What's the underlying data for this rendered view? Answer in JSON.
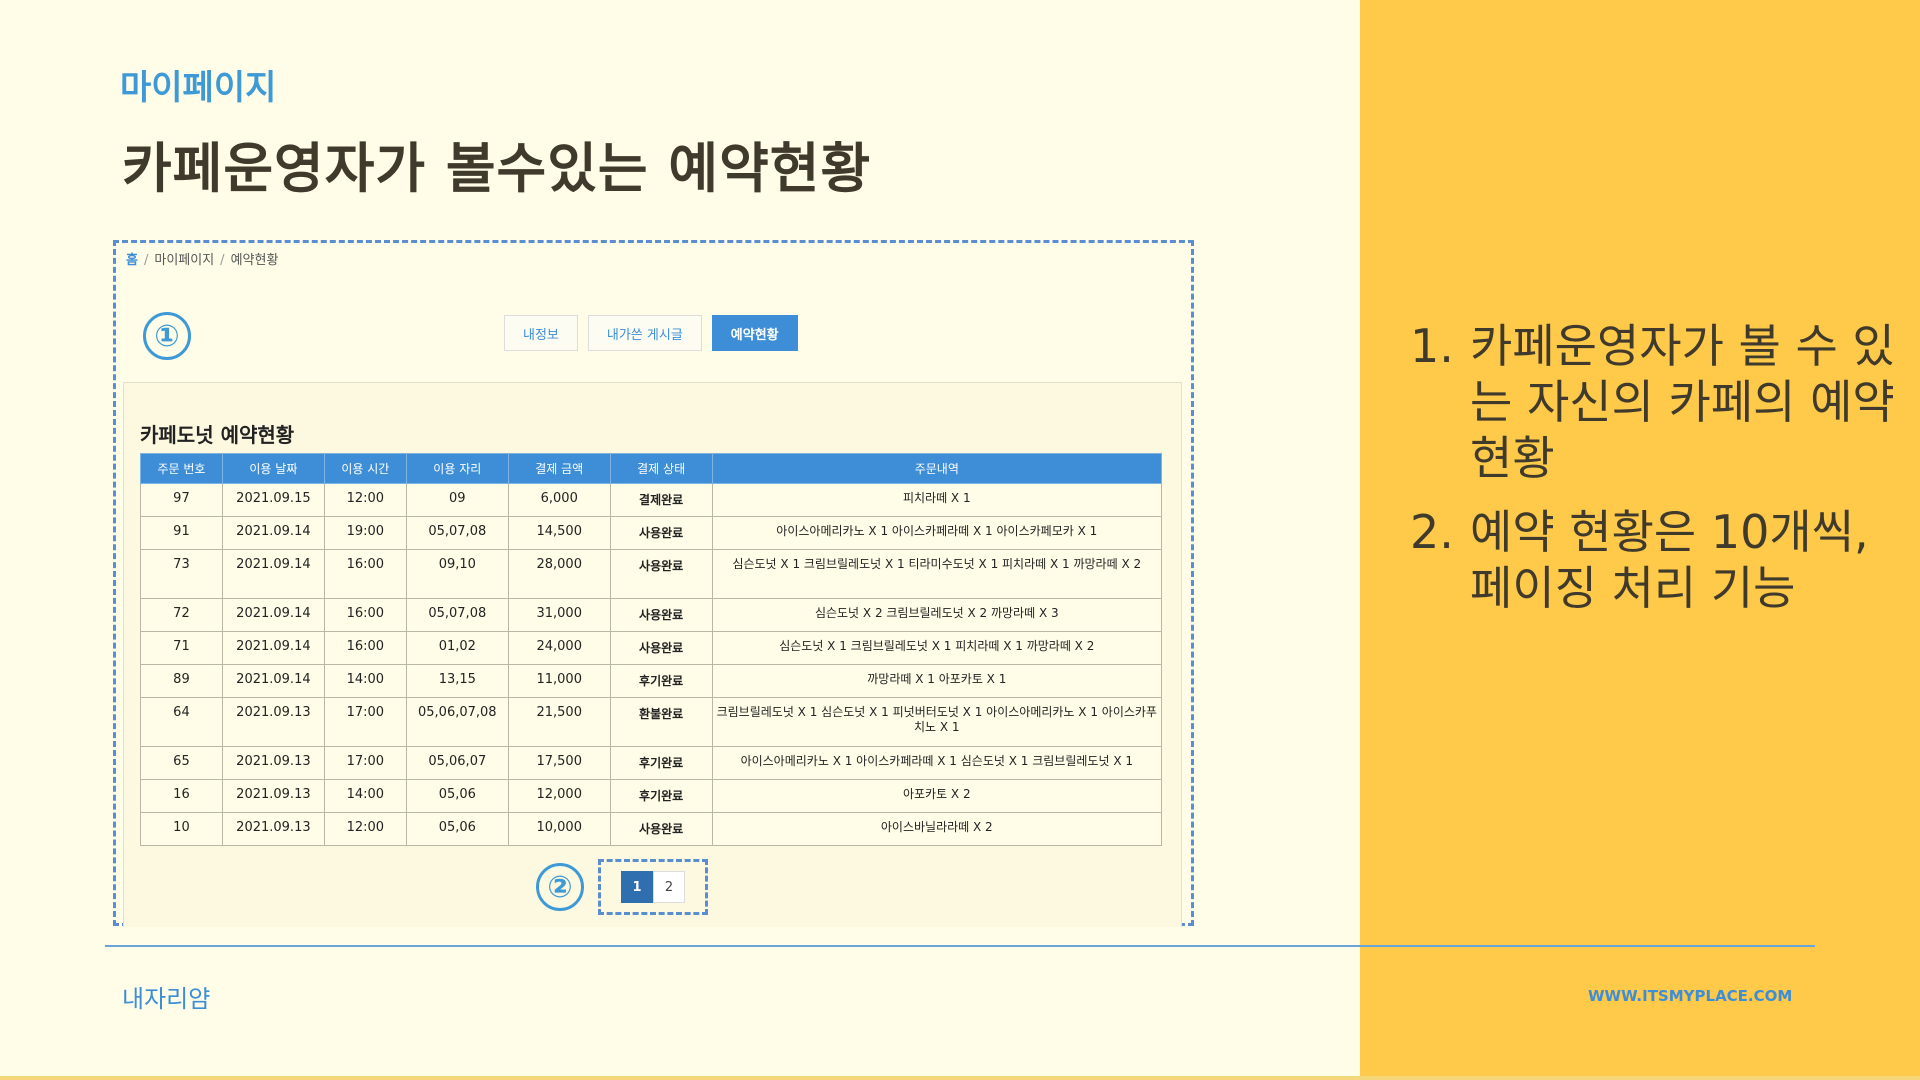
{
  "slide": {
    "subtitle": "마이페이지",
    "title": "카페운영자가 볼수있는 예약현황",
    "brand": "내자리얌",
    "url": "WWW.ITSMYPLACE.COM"
  },
  "screenshot": {
    "breadcrumb": [
      "홈",
      "마이페이지",
      "예약현황"
    ],
    "markers": [
      "①",
      "②"
    ],
    "tabs": [
      {
        "label": "내정보",
        "active": false
      },
      {
        "label": "내가쓴 게시글",
        "active": false
      },
      {
        "label": "예약현황",
        "active": true
      }
    ],
    "section_title": "카페도넛 예약현황",
    "table": {
      "headers": [
        "주문 번호",
        "이용 날짜",
        "이용 시간",
        "이용 자리",
        "결제 금액",
        "결제 상태",
        "주문내역"
      ],
      "rows": [
        [
          "97",
          "2021.09.15",
          "12:00",
          "09",
          "6,000",
          "결제완료",
          "피치라떼 X 1"
        ],
        [
          "91",
          "2021.09.14",
          "19:00",
          "05,07,08",
          "14,500",
          "사용완료",
          "아이스아메리카노 X 1  아이스카페라떼 X 1  아이스카페모카 X 1"
        ],
        [
          "73",
          "2021.09.14",
          "16:00",
          "09,10",
          "28,000",
          "사용완료",
          "심슨도넛 X 1  크림브릴레도넛 X 1  티라미수도넛 X 1  피치라떼 X 1  까망라떼 X 2"
        ],
        [
          "72",
          "2021.09.14",
          "16:00",
          "05,07,08",
          "31,000",
          "사용완료",
          "심슨도넛 X 2  크림브릴레도넛 X 2  까망라떼 X 3"
        ],
        [
          "71",
          "2021.09.14",
          "16:00",
          "01,02",
          "24,000",
          "사용완료",
          "심슨도넛 X 1  크림브릴레도넛 X 1  피치라떼 X 1  까망라떼 X 2"
        ],
        [
          "89",
          "2021.09.14",
          "14:00",
          "13,15",
          "11,000",
          "후기완료",
          "까망라떼 X 1  아포카토 X 1"
        ],
        [
          "64",
          "2021.09.13",
          "17:00",
          "05,06,07,08",
          "21,500",
          "환불완료",
          "크림브릴레도넛 X 1  심슨도넛 X 1  피넛버터도넛 X 1  아이스아메리카노 X 1  아이스카푸치노 X 1"
        ],
        [
          "65",
          "2021.09.13",
          "17:00",
          "05,06,07",
          "17,500",
          "후기완료",
          "아이스아메리카노 X 1  아이스카페라떼 X 1  심슨도넛 X 1  크림브릴레도넛 X 1"
        ],
        [
          "16",
          "2021.09.13",
          "14:00",
          "05,06",
          "12,000",
          "후기완료",
          "아포카토 X 2"
        ],
        [
          "10",
          "2021.09.13",
          "12:00",
          "05,06",
          "10,000",
          "사용완료",
          "아이스바닐라라떼 X 2"
        ]
      ]
    },
    "pagination": {
      "pages": [
        "1",
        "2"
      ],
      "current": "1"
    }
  },
  "notes": [
    {
      "num": "1.",
      "text": "카페운영자가 볼 수 있는 자신의 카페의 예약 현황"
    },
    {
      "num": "2.",
      "text": "예약 현황은 10개씩, 페이징 처리 기능"
    }
  ],
  "colors": {
    "background": "#fffde8",
    "accent_panel": "#ffc94a",
    "brand_blue": "#3d8ed6",
    "title_text": "#3f3a2c"
  }
}
